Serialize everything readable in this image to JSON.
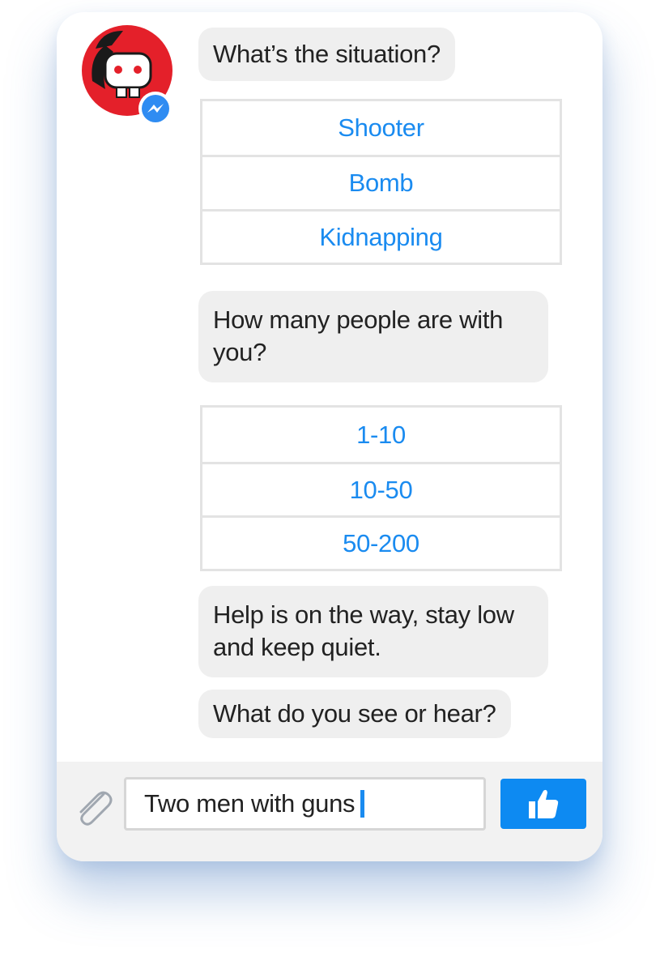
{
  "messages": [
    {
      "text": "What’s the situation?"
    },
    {
      "text": "How many people are with you?"
    },
    {
      "text": "Help is on the way, stay low and keep quiet."
    },
    {
      "text": "What do you see or hear?"
    }
  ],
  "quick_replies_1": [
    "Shooter",
    "Bomb",
    "Kidnapping"
  ],
  "quick_replies_2": [
    "1-10",
    "10-50",
    "50-200"
  ],
  "composer": {
    "input_value": "Two men with guns"
  },
  "icons": {
    "avatar": "bot-avatar-icon",
    "badge": "messenger-icon",
    "attach": "paperclip-icon",
    "send": "thumbs-up-icon"
  },
  "colors": {
    "accent": "#0d8af2",
    "option_text": "#1a8bf0",
    "bubble": "#efefef",
    "avatar_red": "#e4202a"
  }
}
